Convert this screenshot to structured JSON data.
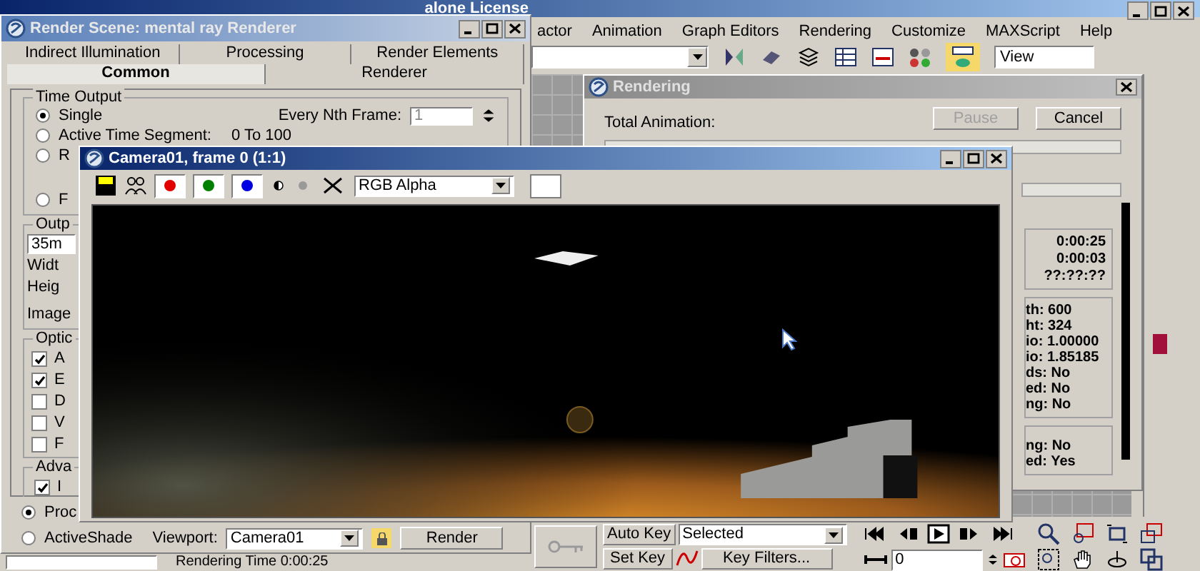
{
  "main_window": {
    "title": "alone License",
    "menu": [
      "actor",
      "Animation",
      "Graph Editors",
      "Rendering",
      "Customize",
      "MAXScript",
      "Help"
    ],
    "view_field": "View"
  },
  "render_scene": {
    "title": "Render Scene: mental ray Renderer",
    "tab_rows": [
      [
        {
          "label": "Indirect Illumination",
          "selected": false
        },
        {
          "label": "Processing",
          "selected": false
        },
        {
          "label": "Render Elements",
          "selected": false
        }
      ],
      [
        {
          "label": "Common",
          "selected": true
        },
        {
          "label": "Renderer",
          "selected": false
        }
      ]
    ],
    "time_output": {
      "title": "Time Output",
      "nth_label": "Every Nth Frame:",
      "nth_value": "1",
      "segment_value": "0 To 100",
      "options": [
        {
          "label": "Single",
          "selected": true
        },
        {
          "label": "Active Time Segment:",
          "selected": false
        },
        {
          "label": "R",
          "selected": false
        },
        {
          "label": "F",
          "selected": false
        }
      ]
    },
    "output_size": {
      "title": "Outp",
      "preset": "35m",
      "labels": [
        "Widt",
        "Heig",
        "Image"
      ]
    },
    "options": {
      "title": "Optic",
      "items": [
        {
          "label": "A",
          "checked": true
        },
        {
          "label": "E",
          "checked": true
        },
        {
          "label": "D",
          "checked": false
        },
        {
          "label": "V",
          "checked": false
        },
        {
          "label": "F",
          "checked": false
        }
      ]
    },
    "advanced": {
      "title": "Adva",
      "items": [
        {
          "label": "I",
          "checked": true
        }
      ]
    },
    "modes": [
      {
        "label": "Proc",
        "selected": true
      },
      {
        "label": "ActiveShade",
        "selected": false
      }
    ],
    "viewport_label": "Viewport:",
    "viewport": "Camera01",
    "render_button": "Render"
  },
  "rendering_dialog": {
    "title": "Rendering",
    "total_label": "Total Animation:",
    "pause": {
      "label": "Pause",
      "disabled": true
    },
    "cancel": {
      "label": "Cancel",
      "disabled": false
    },
    "progress": [
      {
        "level": 0
      },
      {
        "level": 0
      }
    ],
    "times": [
      "0:00:25",
      "0:00:03",
      "??:??:??"
    ],
    "params": [
      "th: 600",
      "ht: 324",
      "io: 1.00000",
      "io: 1.85185",
      "ds: No",
      "ed: No",
      "ng: No"
    ],
    "more_params": [
      "ng: No",
      "ed: Yes"
    ]
  },
  "frame_window": {
    "title": "Camera01, frame 0 (1:1)",
    "channel_select": "RGB Alpha",
    "channels": [
      {
        "color": "#e00000",
        "on": true
      },
      {
        "color": "#008000",
        "on": true
      },
      {
        "color": "#0000e0",
        "on": true
      }
    ]
  },
  "status_bar": {
    "rendering_time": "Rendering Time  0:00:25",
    "auto_key": "Auto Key",
    "set_key": "Set Key",
    "selection": "Selected",
    "key_filters": "Key Filters...",
    "frame": "0"
  }
}
